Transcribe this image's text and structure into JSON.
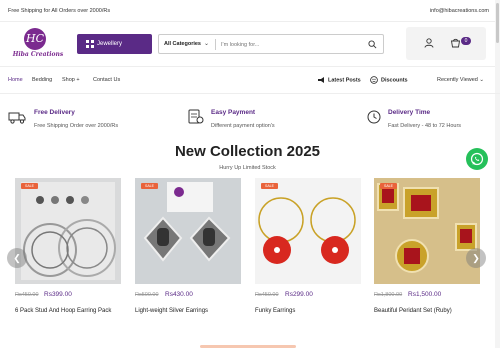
{
  "topbar": {
    "shipping_text": "Free Shipping for All Orders over 2000/Rs",
    "email": "info@hibacreations.com"
  },
  "logo": {
    "initials": "HC",
    "name": "Hiba Creations"
  },
  "category_button": {
    "label": "Jewellery",
    "icon": "grid-icon"
  },
  "search": {
    "category_label": "All Categories",
    "placeholder": "I'm looking for...",
    "icon": "search-icon"
  },
  "account": {
    "cart_count": "0"
  },
  "nav": {
    "items": [
      "Home",
      "Bedding",
      "Shop +",
      "Contact Us"
    ],
    "latest_posts": "Latest Posts",
    "discounts": "Discounts",
    "recently_viewed": "Recently Viewed"
  },
  "features": [
    {
      "title": "Free Delivery",
      "desc": "Free Shipping Order over 2000/Rs",
      "icon": "truck-icon"
    },
    {
      "title": "Easy Payment",
      "desc": "Different payment option's",
      "icon": "payment-icon"
    },
    {
      "title": "Delivery Time",
      "desc": "Fast Delivery - 48 to 72 Hours",
      "icon": "clock-icon"
    }
  ],
  "collection": {
    "title": "New Collection 2025",
    "subtitle": "Hurry Up Limited Stock"
  },
  "products": [
    {
      "sale": "SALE",
      "old_price": "Rs450.00",
      "price": "Rs399.00",
      "title": "6 Pack Stud And Hoop Earring Pack"
    },
    {
      "sale": "SALE",
      "old_price": "Rs500.00",
      "price": "Rs430.00",
      "title": "Light-weight Silver Earrings"
    },
    {
      "sale": "SALE",
      "old_price": "Rs450.00",
      "price": "Rs299.00",
      "title": "Funky Earrings"
    },
    {
      "sale": "SALE",
      "old_price": "Rs1,800.00",
      "price": "Rs1,500.00",
      "title": "Beautiful Peridant Set (Ruby)"
    }
  ],
  "colors": {
    "brand": "#5a2a86",
    "sale": "#e9633b",
    "whatsapp": "#25c05a"
  }
}
